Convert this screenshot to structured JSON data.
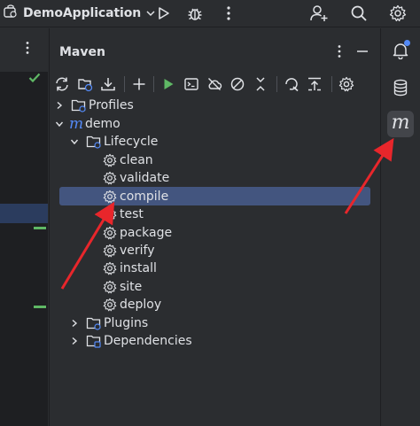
{
  "titlebar": {
    "app_name": "DemoApplication"
  },
  "panel": {
    "title": "Maven"
  },
  "tree": {
    "profiles": "Profiles",
    "project": "demo",
    "lifecycle": "Lifecycle",
    "phases": [
      "clean",
      "validate",
      "compile",
      "test",
      "package",
      "verify",
      "install",
      "site",
      "deploy"
    ],
    "selected_phase": "compile",
    "plugins": "Plugins",
    "dependencies": "Dependencies"
  },
  "rightbar": {
    "maven_glyph": "m"
  },
  "colors": {
    "background": "#2b2d30",
    "editor": "#1e1f22",
    "selection": "#43557f",
    "accent_blue": "#548af7",
    "run_green": "#5fb865",
    "annotation_red": "#e8262b"
  }
}
